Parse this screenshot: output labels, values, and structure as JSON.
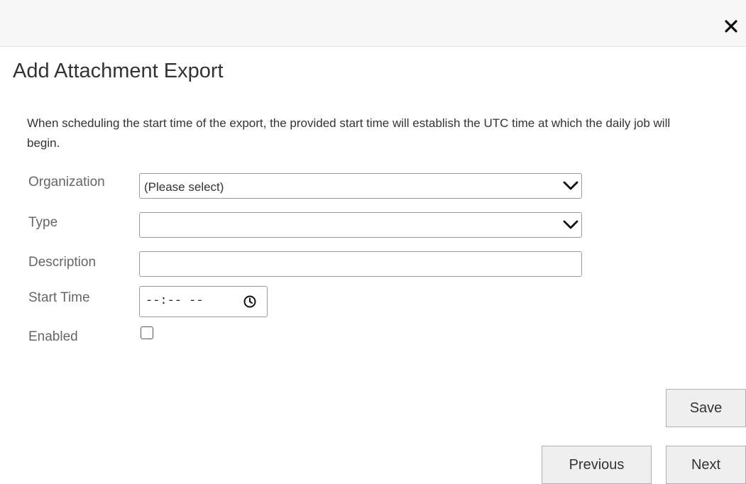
{
  "dialog": {
    "title": "Add Attachment Export",
    "intro": "When scheduling the start time of the export, the provided start time will establish the UTC time at which the daily job will begin."
  },
  "form": {
    "organization": {
      "label": "Organization",
      "selected": "(Please select)"
    },
    "type": {
      "label": "Type",
      "selected": ""
    },
    "description": {
      "label": "Description",
      "value": "",
      "placeholder": ""
    },
    "start_time": {
      "label": "Start Time",
      "value": "--:-- --"
    },
    "enabled": {
      "label": "Enabled",
      "checked": false
    }
  },
  "buttons": {
    "save": "Save",
    "previous": "Previous",
    "next": "Next"
  },
  "icons": {
    "close": "close-icon",
    "dropdown": "chevron-down-icon",
    "time": "clock-icon"
  },
  "colors": {
    "header_bg": "#f7f7f7",
    "label_text": "#666666",
    "button_bg": "#efefef",
    "border": "#9a9a9a"
  }
}
